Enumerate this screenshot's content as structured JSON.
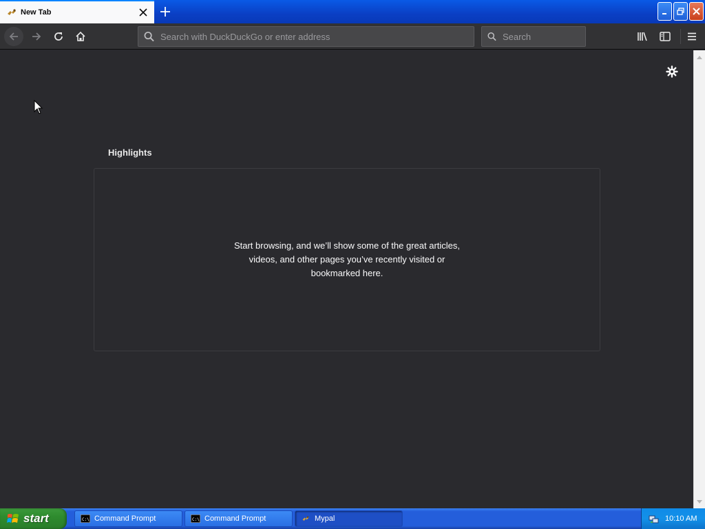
{
  "browser": {
    "tab": {
      "title": "New Tab"
    },
    "urlbar": {
      "placeholder": "Search with DuckDuckGo or enter address"
    },
    "searchbar": {
      "placeholder": "Search"
    }
  },
  "content": {
    "highlights": {
      "title": "Highlights",
      "empty_message": "Start browsing, and we’ll show some of the great articles, videos, and other pages you’ve recently visited or bookmarked here."
    }
  },
  "taskbar": {
    "start_label": "start",
    "tasks": [
      {
        "label": "Command Prompt",
        "icon": "cmd-icon"
      },
      {
        "label": "Command Prompt",
        "icon": "cmd-icon"
      },
      {
        "label": "Mypal",
        "icon": "mypal-icon",
        "active": true
      }
    ],
    "clock": "10:10 AM"
  },
  "colors": {
    "content_bg": "#2a2a2e",
    "toolbar_bg": "#323234",
    "accent": "#0a84ff"
  }
}
